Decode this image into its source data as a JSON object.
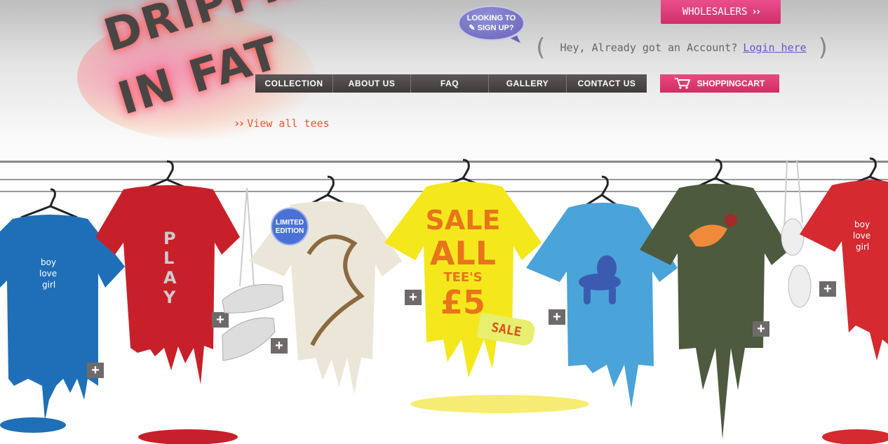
{
  "logo": {
    "line1": "DRIPPING",
    "line2": "IN FAT"
  },
  "view_all": {
    "label": "View all tees",
    "icon": "double-chevron-right-icon"
  },
  "signup": {
    "line1": "LOOKING TO",
    "line2": "SIGN UP?",
    "icon": "pencil-icon"
  },
  "wholesalers": {
    "label": "WHOLESALERS",
    "icon": "double-chevron-right-icon"
  },
  "account": {
    "text": "Hey, Already got an Account?",
    "link": "Login here"
  },
  "nav": {
    "items": [
      {
        "label": "COLLECTION"
      },
      {
        "label": "ABOUT US"
      },
      {
        "label": "FAQ"
      },
      {
        "label": "GALLERY"
      },
      {
        "label": "CONTACT US"
      }
    ]
  },
  "cart": {
    "label": "SHOPPINGCART",
    "icon": "shopping-cart-icon"
  },
  "tees": {
    "t1": {
      "print": "boy love girl",
      "color": "#1f6fb8"
    },
    "t2": {
      "print": "PLAY",
      "color": "#c8202a"
    },
    "t3": {
      "badge": "LIMITED EDITION",
      "color": "#ece6d8"
    },
    "t4": {
      "line1": "SALE",
      "line2": "ALL",
      "line3": "TEE'S",
      "line4": "£5",
      "tag": "SALE",
      "color": "#f4e81c"
    },
    "t5": {
      "color": "#4aa3d9"
    },
    "t6": {
      "color": "#4d5a3d"
    },
    "t7": {
      "print": "boy love girl",
      "color": "#d42a30"
    }
  },
  "plus_icon": "+"
}
